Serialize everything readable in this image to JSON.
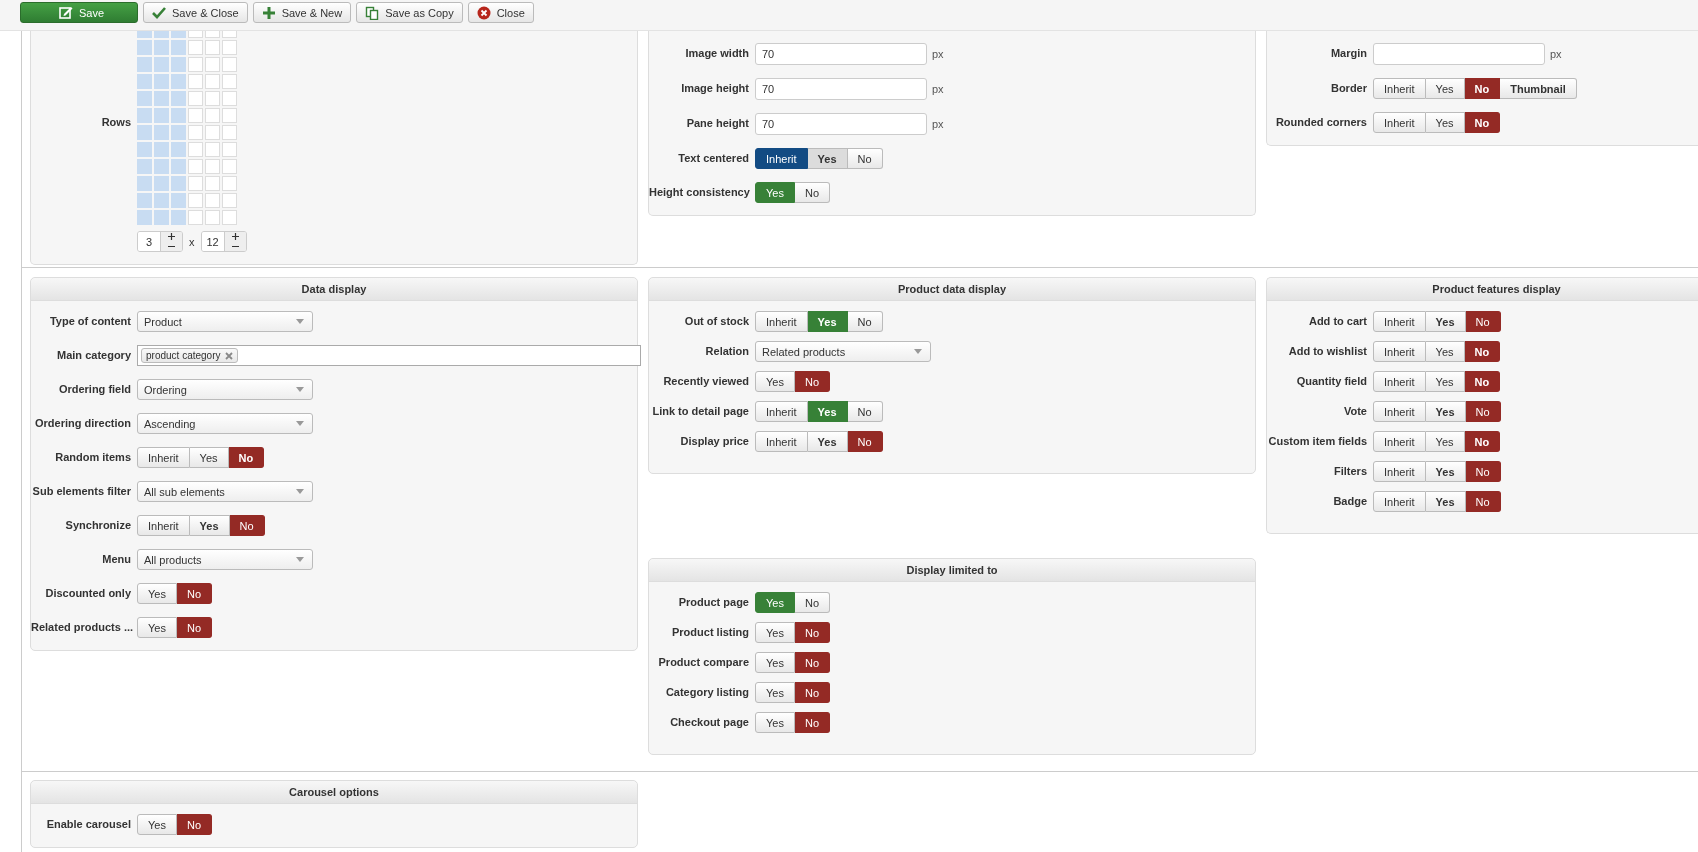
{
  "toolbar": [
    {
      "kind": "save",
      "label": "Save",
      "primary": true
    },
    {
      "kind": "save-close",
      "label": "Save & Close",
      "primary": false
    },
    {
      "kind": "save-new",
      "label": "Save & New",
      "primary": false
    },
    {
      "kind": "save-copy",
      "label": "Save as Copy",
      "primary": false
    },
    {
      "kind": "close",
      "label": "Close",
      "primary": false
    }
  ],
  "sections": [
    {
      "columns": [
        [
          {
            "fields": [
              {
                "kind": "grid",
                "label": "Rows",
                "grid_columns": [
                  {
                    "selected": true
                  },
                  {
                    "selected": true
                  },
                  {
                    "selected": true
                  },
                  {
                    "selected": false
                  },
                  {
                    "selected": false
                  },
                  {
                    "selected": false
                  }
                ],
                "column_count": "3",
                "separator": "x",
                "row_count": "12"
              }
            ]
          }
        ],
        [
          {
            "fields": [
              {
                "kind": "text",
                "label": "Image width",
                "value": "70",
                "unit": "px"
              },
              {
                "kind": "text",
                "label": "Image height",
                "value": "70",
                "unit": "px"
              },
              {
                "kind": "text",
                "label": "Pane height",
                "value": "70",
                "unit": "px"
              },
              {
                "kind": "toggle",
                "label": "Text centered",
                "color": "#124b83",
                "options": [
                  {
                    "label": "Inherit",
                    "selected": true,
                    "emphasis": false,
                    "highlighted": false
                  },
                  {
                    "label": "Yes",
                    "selected": false,
                    "emphasis": true,
                    "highlighted": true
                  },
                  {
                    "label": "No",
                    "selected": false,
                    "emphasis": false,
                    "highlighted": false
                  }
                ]
              },
              {
                "kind": "toggle",
                "label": "Height consistency",
                "color": "#378137",
                "options": [
                  {
                    "label": "Yes",
                    "selected": true,
                    "emphasis": false,
                    "highlighted": false
                  },
                  {
                    "label": "No",
                    "selected": false,
                    "emphasis": false,
                    "highlighted": false
                  }
                ]
              }
            ]
          }
        ],
        [
          {
            "fields": [
              {
                "kind": "text",
                "label": "Margin",
                "unit": "px"
              },
              {
                "kind": "toggle",
                "label": "Border",
                "color": "#942a25",
                "options": [
                  {
                    "label": "Inherit",
                    "selected": false,
                    "emphasis": false,
                    "highlighted": false
                  },
                  {
                    "label": "Yes",
                    "selected": false,
                    "emphasis": false,
                    "highlighted": false
                  },
                  {
                    "label": "No",
                    "selected": true,
                    "emphasis": true,
                    "highlighted": false
                  },
                  {
                    "label": "Thumbnail",
                    "selected": false,
                    "emphasis": true,
                    "highlighted": false
                  }
                ]
              },
              {
                "kind": "toggle",
                "label": "Rounded corners",
                "color": "#942a25",
                "options": [
                  {
                    "label": "Inherit",
                    "selected": false,
                    "emphasis": false,
                    "highlighted": false
                  },
                  {
                    "label": "Yes",
                    "selected": false,
                    "emphasis": false,
                    "highlighted": false
                  },
                  {
                    "label": "No",
                    "selected": true,
                    "emphasis": true,
                    "highlighted": false
                  }
                ]
              }
            ]
          }
        ]
      ]
    },
    {
      "columns": [
        [
          {
            "title": "Data display",
            "fields": [
              {
                "kind": "select",
                "label": "Type of content",
                "value": "Product"
              },
              {
                "kind": "tags",
                "label": "Main category",
                "tags": [
                  "product category"
                ]
              },
              {
                "kind": "select",
                "label": "Ordering field",
                "value": "Ordering"
              },
              {
                "kind": "select",
                "label": "Ordering direction",
                "value": "Ascending"
              },
              {
                "kind": "toggle",
                "label": "Random items",
                "color": "#942a25",
                "options": [
                  {
                    "label": "Inherit",
                    "selected": false,
                    "emphasis": false,
                    "highlighted": false
                  },
                  {
                    "label": "Yes",
                    "selected": false,
                    "emphasis": false,
                    "highlighted": false
                  },
                  {
                    "label": "No",
                    "selected": true,
                    "emphasis": true,
                    "highlighted": false
                  }
                ]
              },
              {
                "kind": "select",
                "label": "Sub elements filter",
                "value": "All sub elements"
              },
              {
                "kind": "toggle",
                "label": "Synchronize",
                "color": "#942a25",
                "options": [
                  {
                    "label": "Inherit",
                    "selected": false,
                    "emphasis": false,
                    "highlighted": false
                  },
                  {
                    "label": "Yes",
                    "selected": false,
                    "emphasis": true,
                    "highlighted": false
                  },
                  {
                    "label": "No",
                    "selected": true,
                    "emphasis": false,
                    "highlighted": false
                  }
                ]
              },
              {
                "kind": "select",
                "label": "Menu",
                "value": "All products"
              },
              {
                "kind": "toggle",
                "label": "Discounted only",
                "color": "#942a25",
                "options": [
                  {
                    "label": "Yes",
                    "selected": false,
                    "emphasis": false,
                    "highlighted": false
                  },
                  {
                    "label": "No",
                    "selected": true,
                    "emphasis": false,
                    "highlighted": false
                  }
                ]
              },
              {
                "kind": "toggle",
                "label": "Related products ...",
                "color": "#942a25",
                "options": [
                  {
                    "label": "Yes",
                    "selected": false,
                    "emphasis": false,
                    "highlighted": false
                  },
                  {
                    "label": "No",
                    "selected": true,
                    "emphasis": false,
                    "highlighted": false
                  }
                ]
              }
            ]
          }
        ],
        [
          {
            "title": "Product data display",
            "fields": [
              {
                "kind": "toggle",
                "label": "Out of stock",
                "color": "#378137",
                "options": [
                  {
                    "label": "Inherit",
                    "selected": false,
                    "emphasis": false,
                    "highlighted": false
                  },
                  {
                    "label": "Yes",
                    "selected": true,
                    "emphasis": true,
                    "highlighted": false
                  },
                  {
                    "label": "No",
                    "selected": false,
                    "emphasis": false,
                    "highlighted": false
                  }
                ]
              },
              {
                "kind": "select",
                "label": "Relation",
                "value": "Related products"
              },
              {
                "kind": "toggle",
                "label": "Recently viewed",
                "color": "#942a25",
                "options": [
                  {
                    "label": "Yes",
                    "selected": false,
                    "emphasis": false,
                    "highlighted": false
                  },
                  {
                    "label": "No",
                    "selected": true,
                    "emphasis": false,
                    "highlighted": false
                  }
                ]
              },
              {
                "kind": "toggle",
                "label": "Link to detail page",
                "color": "#378137",
                "options": [
                  {
                    "label": "Inherit",
                    "selected": false,
                    "emphasis": false,
                    "highlighted": false
                  },
                  {
                    "label": "Yes",
                    "selected": true,
                    "emphasis": true,
                    "highlighted": false
                  },
                  {
                    "label": "No",
                    "selected": false,
                    "emphasis": false,
                    "highlighted": false
                  }
                ]
              },
              {
                "kind": "toggle",
                "label": "Display price",
                "color": "#942a25",
                "options": [
                  {
                    "label": "Inherit",
                    "selected": false,
                    "emphasis": false,
                    "highlighted": false
                  },
                  {
                    "label": "Yes",
                    "selected": false,
                    "emphasis": true,
                    "highlighted": false
                  },
                  {
                    "label": "No",
                    "selected": true,
                    "emphasis": false,
                    "highlighted": false
                  }
                ]
              }
            ]
          },
          {
            "title": "Display limited to",
            "fields": [
              {
                "kind": "toggle",
                "label": "Product page",
                "color": "#378137",
                "options": [
                  {
                    "label": "Yes",
                    "selected": true,
                    "emphasis": false,
                    "highlighted": false
                  },
                  {
                    "label": "No",
                    "selected": false,
                    "emphasis": false,
                    "highlighted": false
                  }
                ]
              },
              {
                "kind": "toggle",
                "label": "Product listing",
                "color": "#942a25",
                "options": [
                  {
                    "label": "Yes",
                    "selected": false,
                    "emphasis": false,
                    "highlighted": false
                  },
                  {
                    "label": "No",
                    "selected": true,
                    "emphasis": false,
                    "highlighted": false
                  }
                ]
              },
              {
                "kind": "toggle",
                "label": "Product compare",
                "color": "#942a25",
                "options": [
                  {
                    "label": "Yes",
                    "selected": false,
                    "emphasis": false,
                    "highlighted": false
                  },
                  {
                    "label": "No",
                    "selected": true,
                    "emphasis": false,
                    "highlighted": false
                  }
                ]
              },
              {
                "kind": "toggle",
                "label": "Category listing",
                "color": "#942a25",
                "options": [
                  {
                    "label": "Yes",
                    "selected": false,
                    "emphasis": false,
                    "highlighted": false
                  },
                  {
                    "label": "No",
                    "selected": true,
                    "emphasis": false,
                    "highlighted": false
                  }
                ]
              },
              {
                "kind": "toggle",
                "label": "Checkout page",
                "color": "#942a25",
                "options": [
                  {
                    "label": "Yes",
                    "selected": false,
                    "emphasis": false,
                    "highlighted": false
                  },
                  {
                    "label": "No",
                    "selected": true,
                    "emphasis": false,
                    "highlighted": false
                  }
                ]
              }
            ]
          }
        ],
        [
          {
            "title": "Product features display",
            "fields": [
              {
                "kind": "toggle",
                "label": "Add to cart",
                "color": "#942a25",
                "options": [
                  {
                    "label": "Inherit",
                    "selected": false,
                    "emphasis": false,
                    "highlighted": false
                  },
                  {
                    "label": "Yes",
                    "selected": false,
                    "emphasis": true,
                    "highlighted": false
                  },
                  {
                    "label": "No",
                    "selected": true,
                    "emphasis": false,
                    "highlighted": false
                  }
                ]
              },
              {
                "kind": "toggle",
                "label": "Add to wishlist",
                "color": "#942a25",
                "options": [
                  {
                    "label": "Inherit",
                    "selected": false,
                    "emphasis": false,
                    "highlighted": false
                  },
                  {
                    "label": "Yes",
                    "selected": false,
                    "emphasis": false,
                    "highlighted": false
                  },
                  {
                    "label": "No",
                    "selected": true,
                    "emphasis": true,
                    "highlighted": false
                  }
                ]
              },
              {
                "kind": "toggle",
                "label": "Quantity field",
                "color": "#942a25",
                "options": [
                  {
                    "label": "Inherit",
                    "selected": false,
                    "emphasis": false,
                    "highlighted": false
                  },
                  {
                    "label": "Yes",
                    "selected": false,
                    "emphasis": false,
                    "highlighted": false
                  },
                  {
                    "label": "No",
                    "selected": true,
                    "emphasis": true,
                    "highlighted": false
                  }
                ]
              },
              {
                "kind": "toggle",
                "label": "Vote",
                "color": "#942a25",
                "options": [
                  {
                    "label": "Inherit",
                    "selected": false,
                    "emphasis": false,
                    "highlighted": false
                  },
                  {
                    "label": "Yes",
                    "selected": false,
                    "emphasis": true,
                    "highlighted": false
                  },
                  {
                    "label": "No",
                    "selected": true,
                    "emphasis": false,
                    "highlighted": false
                  }
                ]
              },
              {
                "kind": "toggle",
                "label": "Custom item fields",
                "color": "#942a25",
                "options": [
                  {
                    "label": "Inherit",
                    "selected": false,
                    "emphasis": false,
                    "highlighted": false
                  },
                  {
                    "label": "Yes",
                    "selected": false,
                    "emphasis": false,
                    "highlighted": false
                  },
                  {
                    "label": "No",
                    "selected": true,
                    "emphasis": true,
                    "highlighted": false
                  }
                ]
              },
              {
                "kind": "toggle",
                "label": "Filters",
                "color": "#942a25",
                "options": [
                  {
                    "label": "Inherit",
                    "selected": false,
                    "emphasis": false,
                    "highlighted": false
                  },
                  {
                    "label": "Yes",
                    "selected": false,
                    "emphasis": true,
                    "highlighted": false
                  },
                  {
                    "label": "No",
                    "selected": true,
                    "emphasis": false,
                    "highlighted": false
                  }
                ]
              },
              {
                "kind": "toggle",
                "label": "Badge",
                "color": "#942a25",
                "options": [
                  {
                    "label": "Inherit",
                    "selected": false,
                    "emphasis": false,
                    "highlighted": false
                  },
                  {
                    "label": "Yes",
                    "selected": false,
                    "emphasis": true,
                    "highlighted": false
                  },
                  {
                    "label": "No",
                    "selected": true,
                    "emphasis": false,
                    "highlighted": false
                  }
                ]
              }
            ]
          }
        ]
      ]
    },
    {
      "columns": [
        [
          {
            "title": "Carousel options",
            "fields": [
              {
                "kind": "toggle",
                "label": "Enable carousel",
                "color": "#942a25",
                "options": [
                  {
                    "label": "Yes",
                    "selected": false,
                    "emphasis": false,
                    "highlighted": false
                  },
                  {
                    "label": "No",
                    "selected": true,
                    "emphasis": false,
                    "highlighted": false
                  }
                ]
              }
            ]
          }
        ],
        [],
        []
      ]
    }
  ]
}
